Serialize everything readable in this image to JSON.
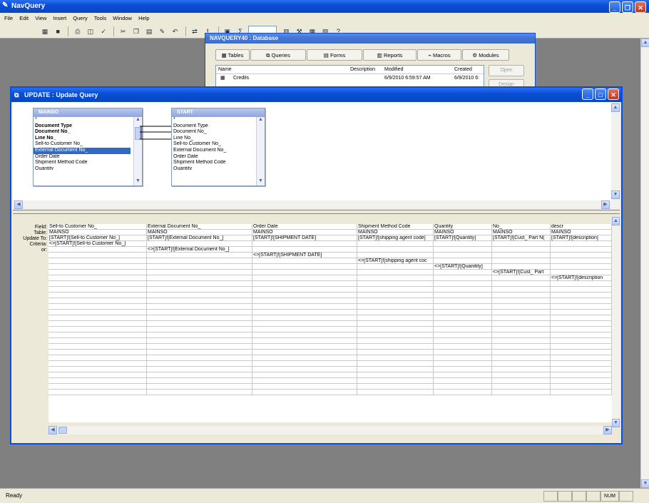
{
  "app": {
    "title": "NavQuery",
    "status": "Ready",
    "num": "NUM"
  },
  "menu": [
    "File",
    "Edit",
    "View",
    "Insert",
    "Query",
    "Tools",
    "Window",
    "Help"
  ],
  "db_window": {
    "title": "NAVQUERY40 : Database",
    "tabs": [
      "Tables",
      "Queries",
      "Forms",
      "Reports",
      "Macros",
      "Modules"
    ],
    "col_name": "Name",
    "col_desc": "Description",
    "col_modified": "Modified",
    "col_created": "Created",
    "row_name": "Credits",
    "row_modified": "6/9/2010 6:59:57 AM",
    "row_created": "6/9/2010 6:",
    "open_btn": "Open",
    "design_btn": "Design"
  },
  "query_window": {
    "title": "UPDATE : Update Query"
  },
  "table_mainso": {
    "name": "MAINSO",
    "fields": [
      "*",
      "Document Type",
      "Document No_",
      "Line No_",
      "Sell-to Customer No_",
      "External Document No_",
      "Order Date",
      "Shipment Method Code",
      "Quantity"
    ]
  },
  "table_start": {
    "name": "START",
    "fields": [
      "*",
      "Document Type",
      "Document No_",
      "Line No_",
      "Sell-to Customer No_",
      "External Document No_",
      "Order Date",
      "Shipment Method Code",
      "Quantity"
    ]
  },
  "grid": {
    "labels": [
      "Field:",
      "Table:",
      "Update To:",
      "Criteria:",
      "or:"
    ],
    "columns": [
      {
        "field": "Sell-to Customer No_",
        "table": "MAINSO",
        "update": "[START]![Sell-to Customer No_]",
        "crit": "<>[START]![Sell-to Customer No_]"
      },
      {
        "field": "External Document No_",
        "table": "MAINSO",
        "update": "[START]![External Document No_]",
        "crit": "<>[START]![External Document No_]"
      },
      {
        "field": "Order Date",
        "table": "MAINSO",
        "update": "[START]![SHIPMENT DATE]",
        "crit": "<>[START]![SHIPMENT DATE]"
      },
      {
        "field": "Shipment Method Code",
        "table": "MAINSO",
        "update": "[START]![shipping agent code]",
        "crit": "<>[START]![shipping agent coc"
      },
      {
        "field": "Quantity",
        "table": "MAINSO",
        "update": "[START]![Quantity]",
        "crit": "<>[START]![Quanitity]"
      },
      {
        "field": "No_",
        "table": "MAINSO",
        "update": "[START]![Cust_ Part N(",
        "crit": "<>[START]![Cust_ Part"
      },
      {
        "field": "descr",
        "table": "MAINSO",
        "update": "[START]![description]",
        "crit": "<>[START]![description"
      }
    ]
  }
}
